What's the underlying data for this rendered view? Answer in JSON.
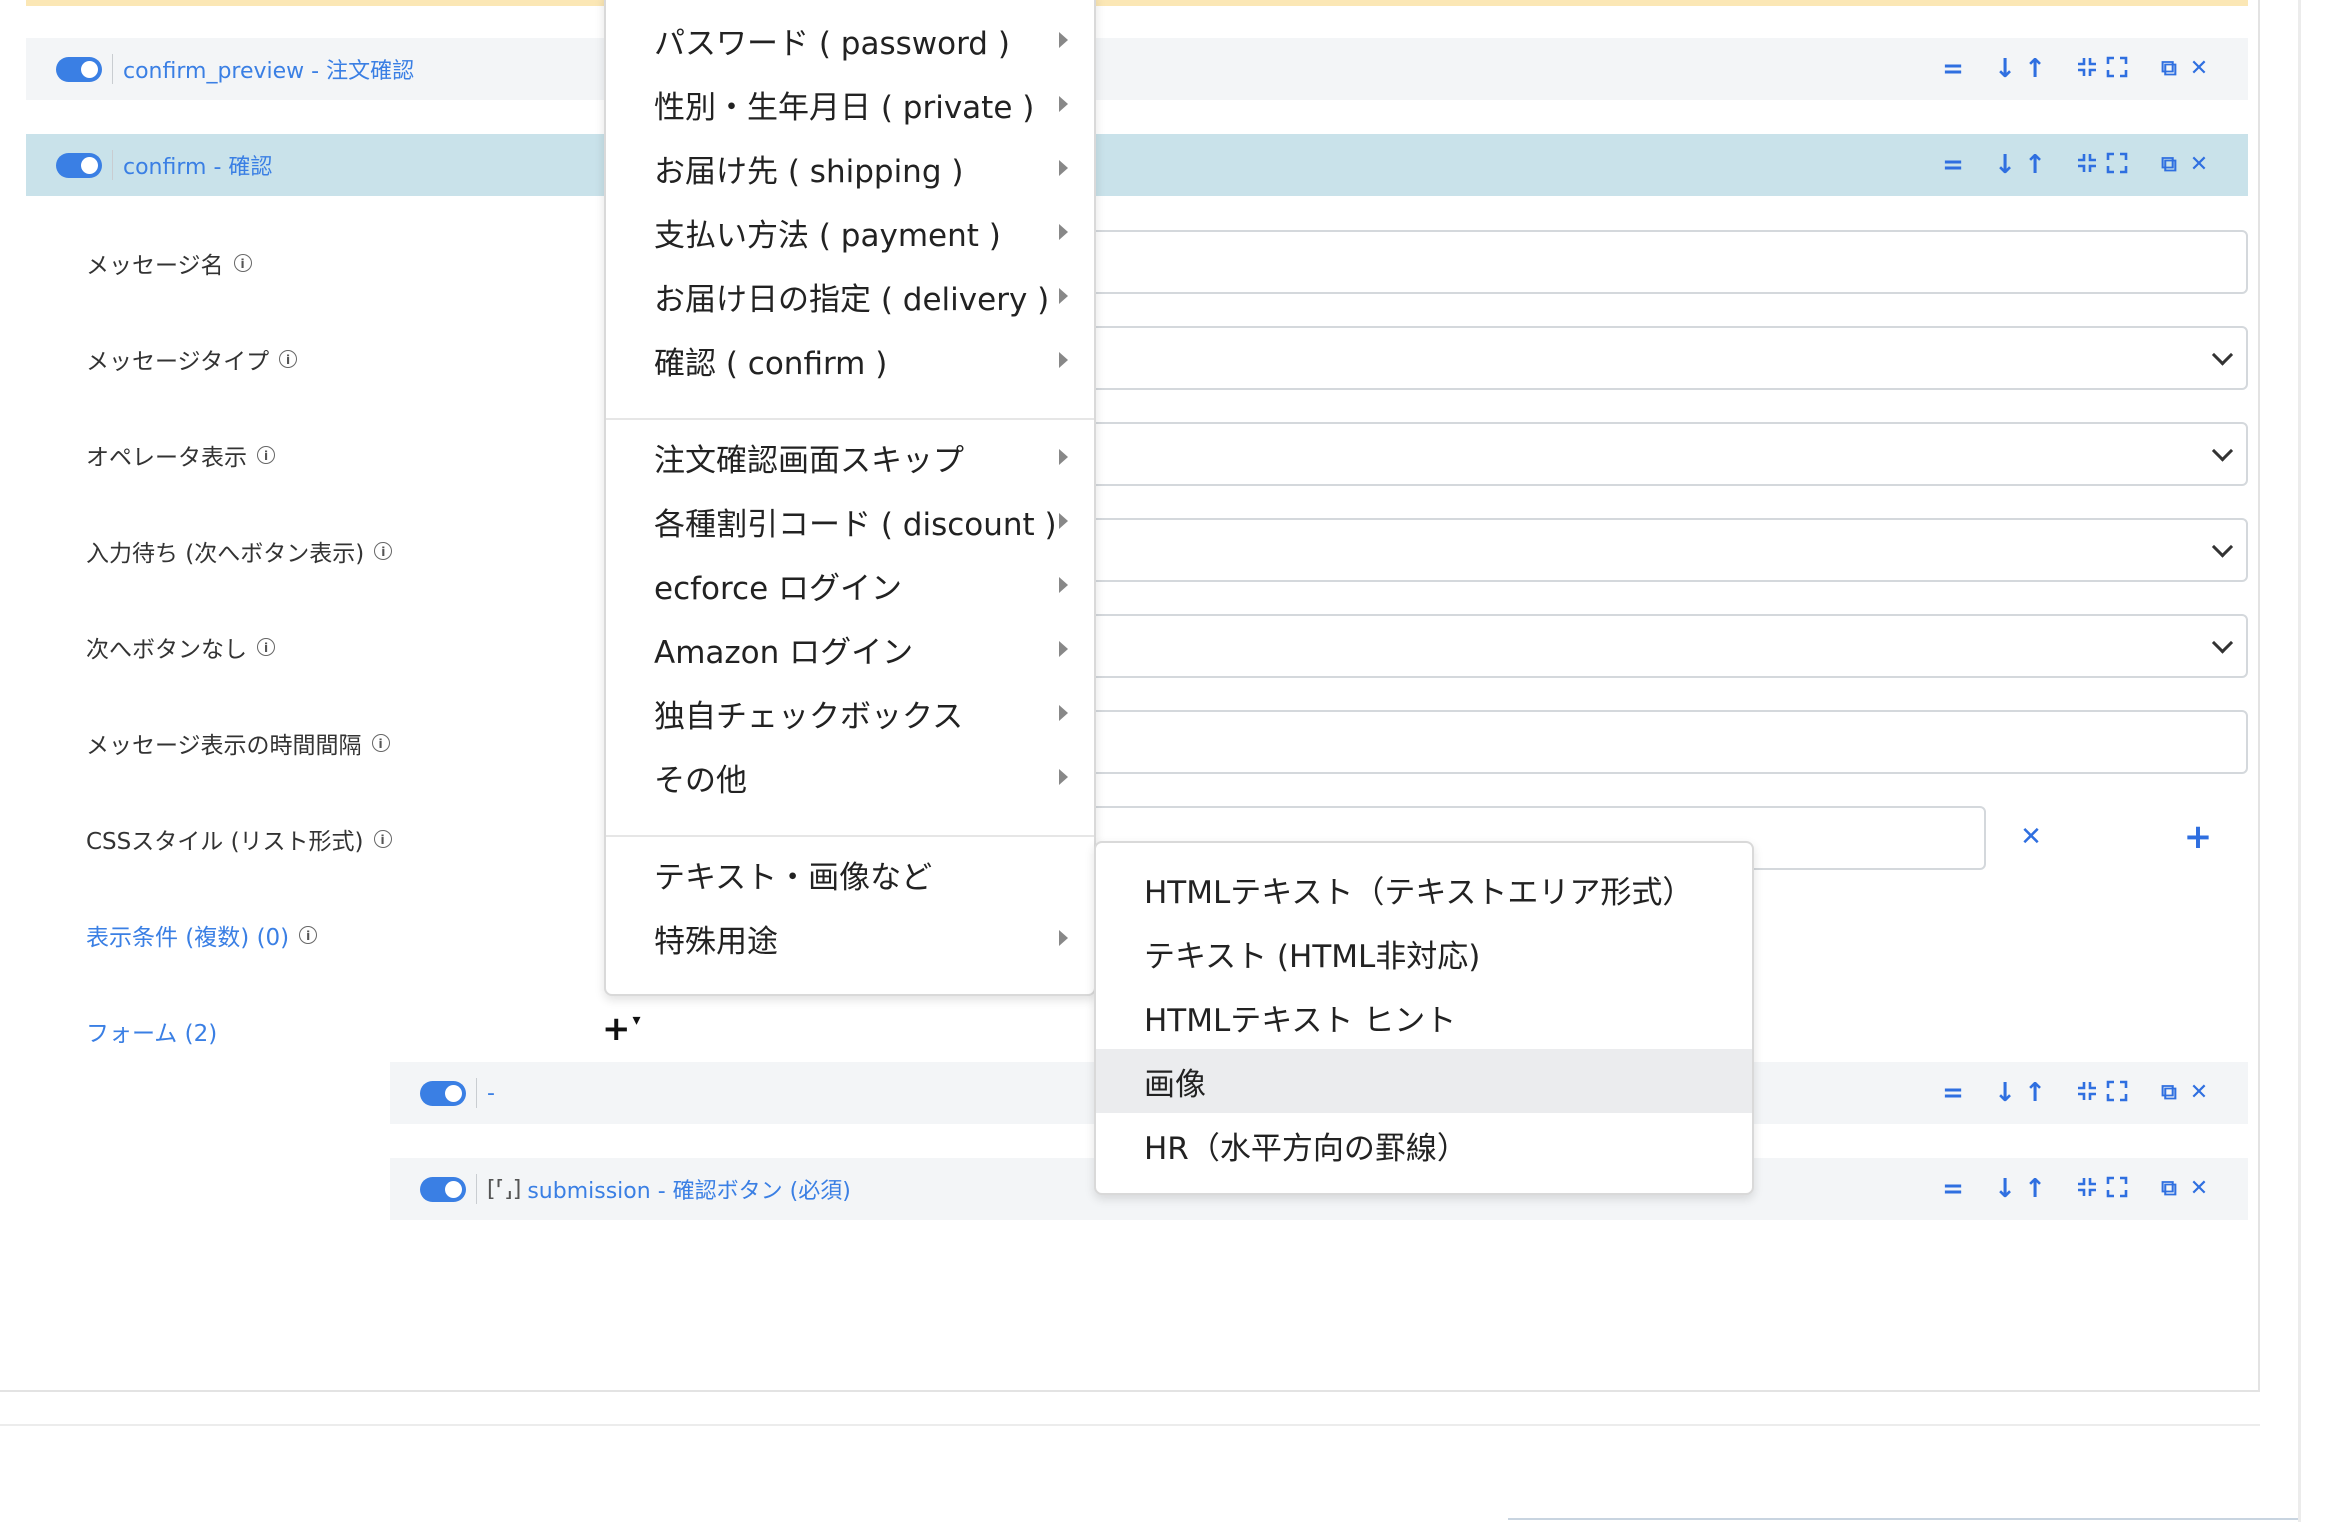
{
  "blocks": {
    "confirm_preview": {
      "title": "confirm_preview - 注文確認"
    },
    "confirm": {
      "title": "confirm - 確認"
    }
  },
  "controls": {
    "eq": "=",
    "down": "↓",
    "up": "↑",
    "dup": "⧉",
    "close": "✕"
  },
  "labels": {
    "message_name": "メッセージ名",
    "message_type": "メッセージタイプ",
    "operator_display": "オペレータ表示",
    "wait_input": "入力待ち (次へボタン表示)",
    "no_next_button": "次へボタンなし",
    "message_interval": "メッセージ表示の時間間隔",
    "css_style": "CSSスタイル (リスト形式)",
    "display_conditions": "表示条件 (複数) (0)",
    "forms": "フォーム (2)",
    "info_glyph": "i"
  },
  "css_row": {
    "remove": "✕",
    "add": "+"
  },
  "add_control": {
    "plus": "+",
    "caret": "▾"
  },
  "forms": [
    {
      "title": "-"
    },
    {
      "frame": "[⸢⸥]",
      "title": "submission - 確認ボタン (必須)"
    }
  ],
  "menu": {
    "items": [
      {
        "label": "パスワード ( password )"
      },
      {
        "label": "性別・生年月日 ( private )"
      },
      {
        "label": "お届け先 ( shipping )"
      },
      {
        "label": "支払い方法 ( payment )"
      },
      {
        "label": "お届け日の指定 ( delivery )"
      },
      {
        "label": "確認 ( confirm )"
      },
      {
        "label": "注文確認画面スキップ"
      },
      {
        "label": "各種割引コード ( discount )"
      },
      {
        "label": "ecforce ログイン"
      },
      {
        "label": "Amazon ログイン"
      },
      {
        "label": "独自チェックボックス"
      },
      {
        "label": "その他"
      },
      {
        "label": "テキスト・画像など"
      },
      {
        "label": "特殊用途"
      }
    ]
  },
  "submenu": {
    "items": [
      {
        "label": "HTMLテキスト（テキストエリア形式）"
      },
      {
        "label": "テキスト (HTML非対応)"
      },
      {
        "label": "HTMLテキスト ヒント"
      },
      {
        "label": "画像"
      },
      {
        "label": "HR（水平方向の罫線）"
      }
    ]
  }
}
